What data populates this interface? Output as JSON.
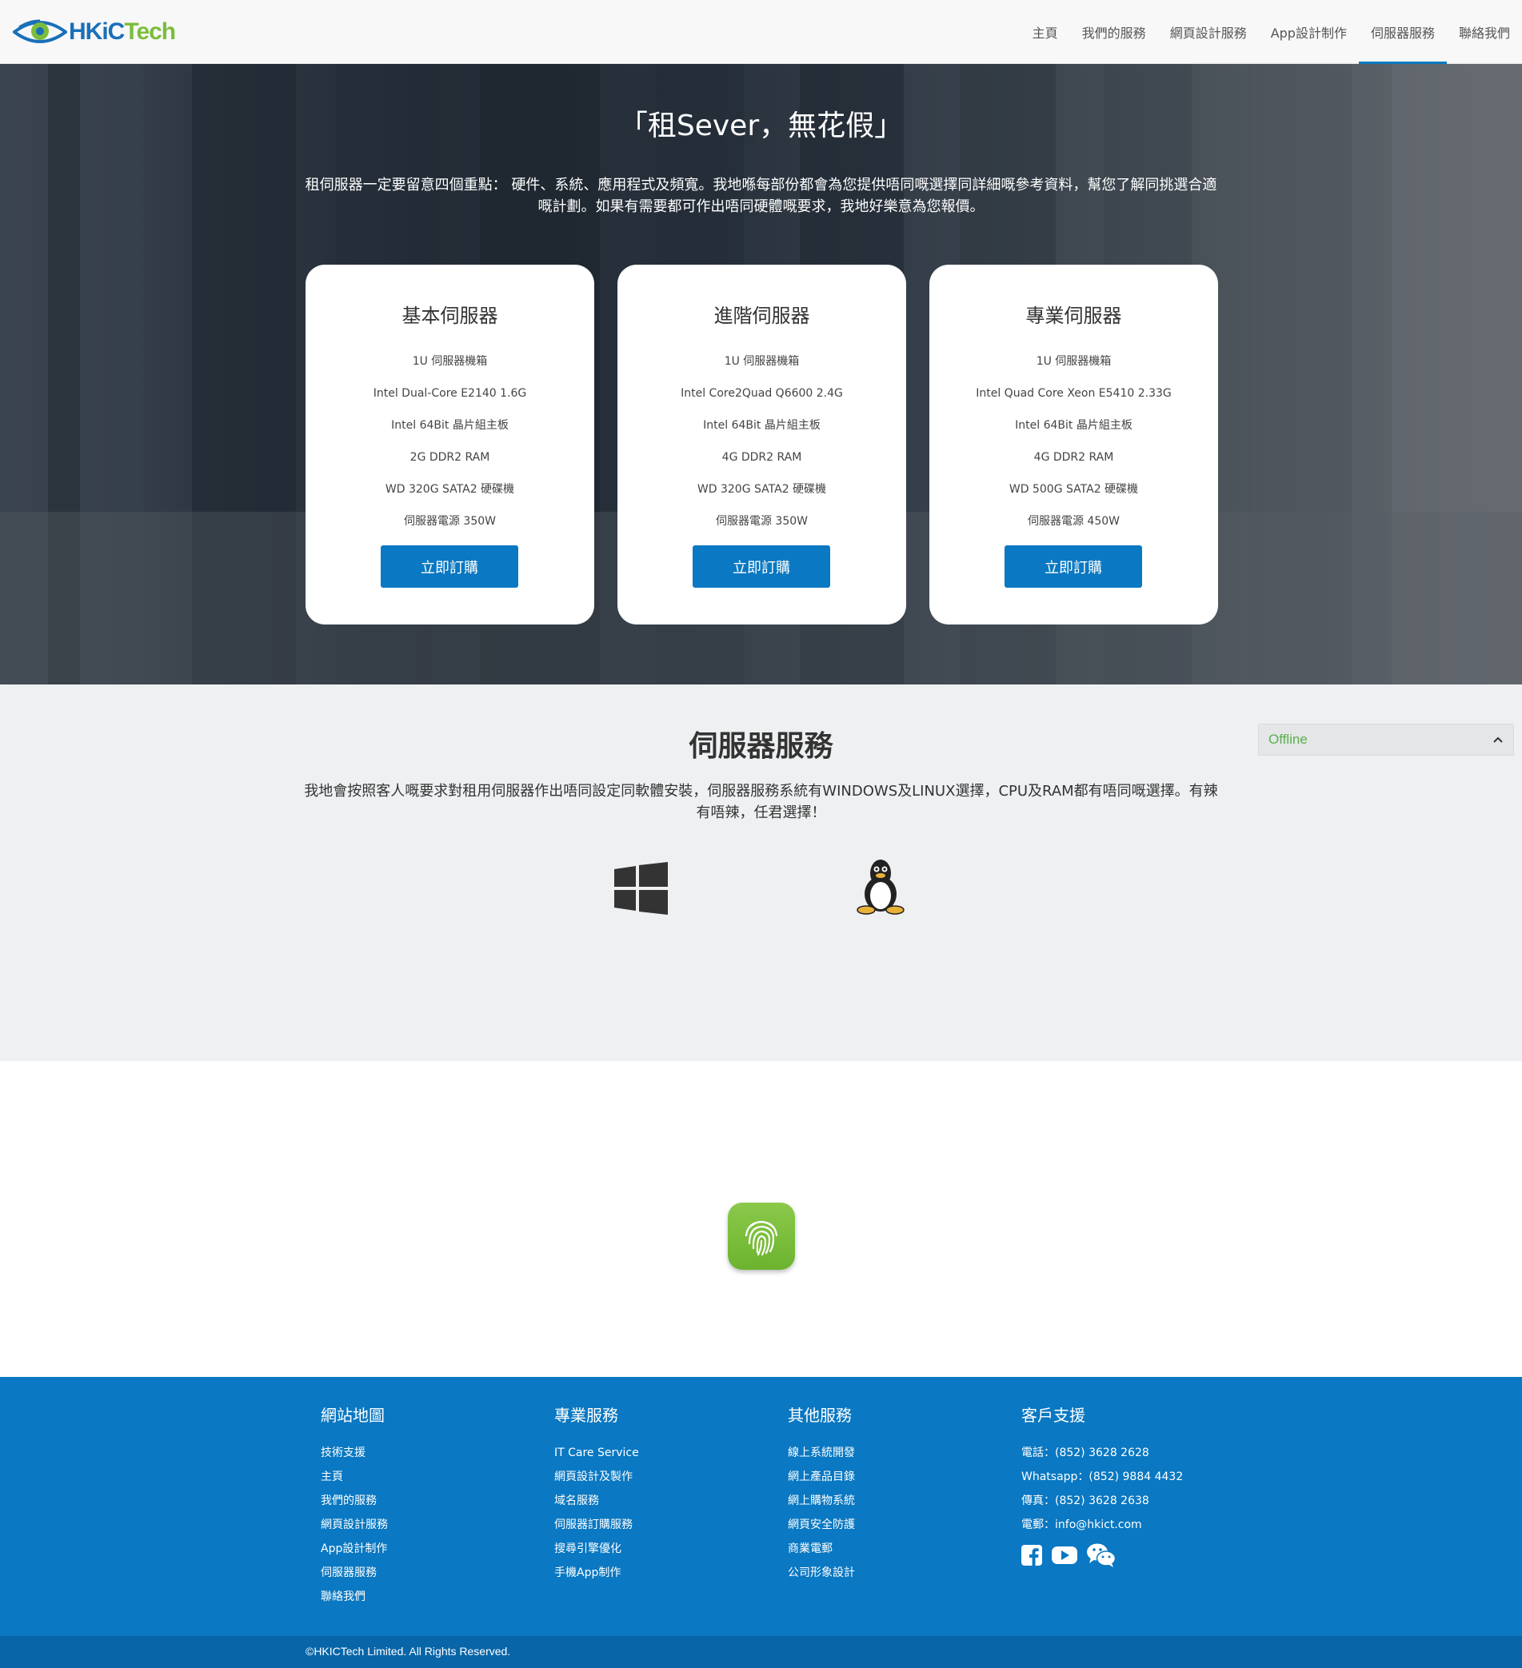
{
  "brand": {
    "logo_hk": "HKiC",
    "logo_tech": "Tech"
  },
  "nav": {
    "items": [
      {
        "label": "主頁"
      },
      {
        "label": "我們的服務"
      },
      {
        "label": "網頁設計服務"
      },
      {
        "label": "App設計制作"
      },
      {
        "label": "伺服器服務",
        "active": true
      },
      {
        "label": "聯絡我們"
      }
    ]
  },
  "hero": {
    "title": "「租Sever，無花假」",
    "description": "租伺服器一定要留意四個重點： 硬件、系統、應用程式及頻寬。我地喺每部份都會為您提供唔同嘅選擇同詳細嘅參考資料，幫您了解同挑選合適嘅計劃。如果有需要都可作出唔同硬體嘅要求，我地好樂意為您報價。"
  },
  "plans": [
    {
      "title": "基本伺服器",
      "specs": [
        "1U 伺服器機箱",
        "Intel Dual-Core E2140 1.6G",
        "Intel 64Bit 晶片組主板",
        "2G DDR2 RAM",
        "WD 320G SATA2 硬碟機",
        "伺服器電源 350W"
      ],
      "button": "立即訂購"
    },
    {
      "title": "進階伺服器",
      "specs": [
        "1U 伺服器機箱",
        "Intel Core2Quad Q6600 2.4G",
        "Intel 64Bit 晶片組主板",
        "4G DDR2 RAM",
        "WD 320G SATA2 硬碟機",
        "伺服器電源 350W"
      ],
      "button": "立即訂購"
    },
    {
      "title": "專業伺服器",
      "specs": [
        "1U 伺服器機箱",
        "Intel Quad Core Xeon E5410 2.33G",
        "Intel 64Bit 晶片組主板",
        "4G DDR2 RAM",
        "WD 500G SATA2 硬碟機",
        "伺服器電源 450W"
      ],
      "button": "立即訂購"
    }
  ],
  "service": {
    "title": "伺服器服務",
    "description": "我地會按照客人嘅要求對租用伺服器作出唔同設定同軟體安裝，伺服器服務系統有WINDOWS及LINUX選擇，CPU及RAM都有唔同嘅選擇。有辣有唔辣，任君選擇！",
    "icons": [
      "windows-icon",
      "linux-icon"
    ]
  },
  "chat": {
    "status": "Offline"
  },
  "fingerprint_icon": "fingerprint-icon",
  "footer": {
    "columns": [
      {
        "title": "網站地圖",
        "items": [
          "技術支援",
          "主頁",
          "我們的服務",
          "網頁設計服務",
          "App設計制作",
          "伺服器服務",
          "聯絡我們"
        ]
      },
      {
        "title": "專業服務",
        "items": [
          "IT Care Service",
          "網頁設計及製作",
          "域名服務",
          "伺服器訂購服務",
          "搜尋引擎優化",
          "手機App制作"
        ]
      },
      {
        "title": "其他服務",
        "items": [
          "線上系統開發",
          "網上產品目錄",
          "網上購物系統",
          "網頁安全防護",
          "商業電郵",
          "公司形象設計"
        ]
      },
      {
        "title": "客戶支援",
        "items": [
          "電話：(852) 3628 2628",
          "Whatsapp：(852) 9884 4432",
          "傳真：(852) 3628 2638",
          "電郵：info@hkict.com"
        ]
      }
    ],
    "socials": [
      "facebook-icon",
      "youtube-icon",
      "wechat-icon"
    ],
    "copyright": "©HKICTech Limited. All Rights Reserved."
  },
  "colors": {
    "primary": "#0a78c2",
    "footer_bottom": "#0866a8",
    "section_gray": "#eef0f2",
    "brand_green": "#7bbd3c",
    "brand_blue": "#1a6fb9"
  }
}
